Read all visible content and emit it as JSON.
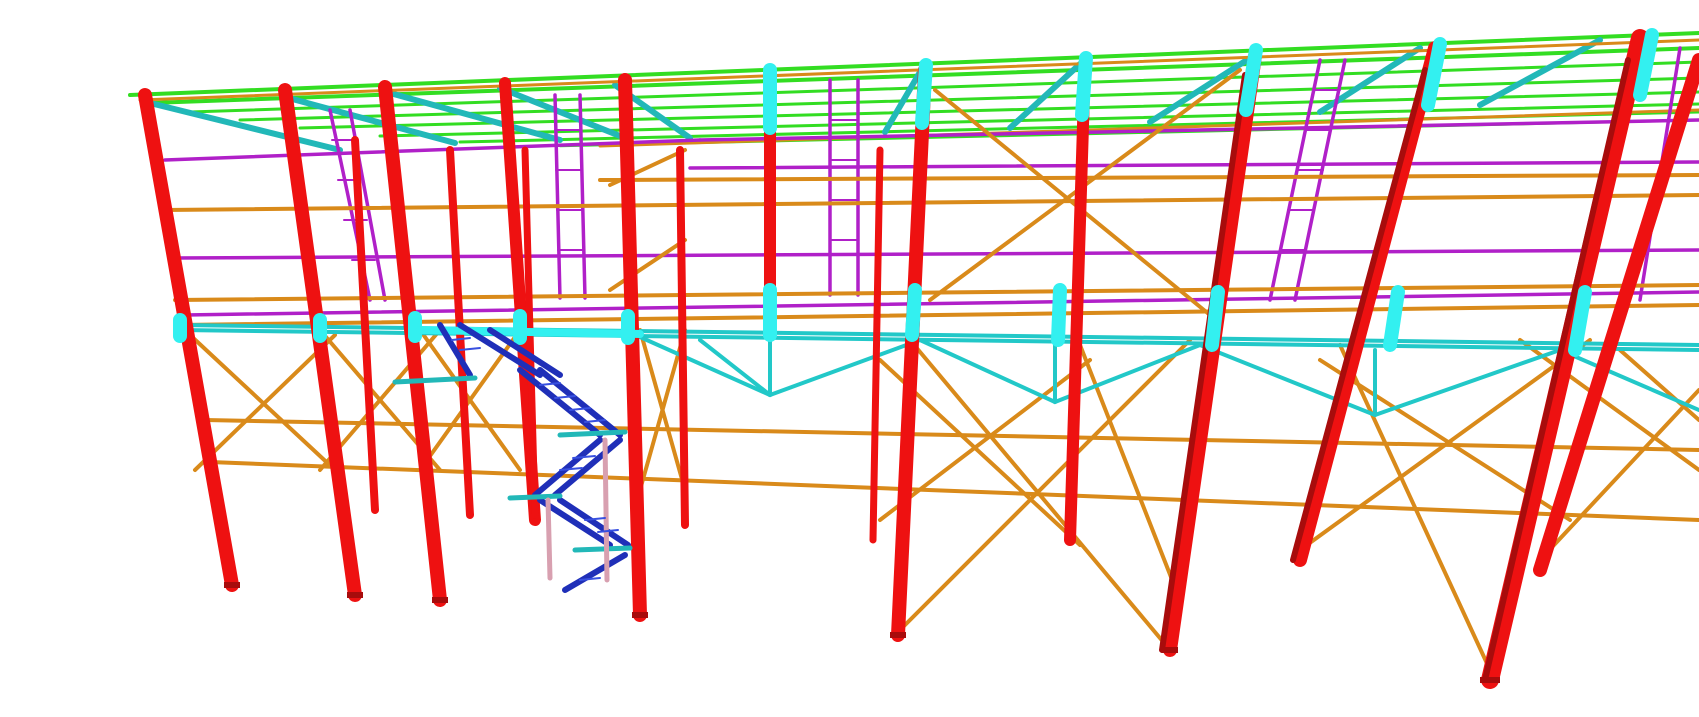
{
  "model": {
    "groups": [
      {
        "id": "roof",
        "color": "#33dd22"
      },
      {
        "id": "brace",
        "color": "#d98a1a"
      },
      {
        "id": "column",
        "color": "#ee1111"
      },
      {
        "id": "column-shade",
        "color": "#a80c0c"
      },
      {
        "id": "purlin",
        "color": "#b020c8"
      },
      {
        "id": "truss",
        "color": "#22c8c8"
      },
      {
        "id": "cap",
        "color": "#33f0f0"
      },
      {
        "id": "stair",
        "color": "#1f2fb8"
      },
      {
        "id": "post",
        "color": "#d8a0b0"
      }
    ]
  }
}
